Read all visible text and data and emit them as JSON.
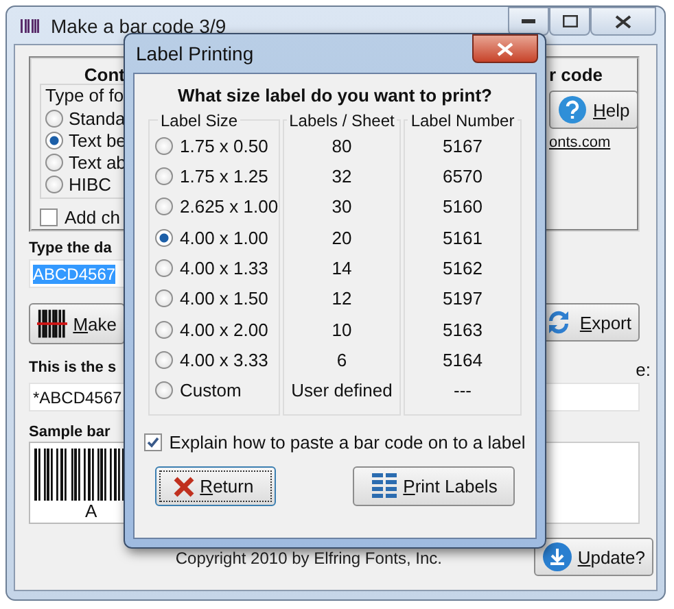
{
  "window": {
    "title": "Make a bar code 3/9"
  },
  "options": {
    "heading": "Cont",
    "type_label": "Type of fo",
    "types": [
      {
        "label": "Standa",
        "selected": false
      },
      {
        "label": "Text be",
        "selected": true
      },
      {
        "label": "Text ab",
        "selected": false
      },
      {
        "label": "HIBC",
        "selected": false
      }
    ],
    "check_digit": {
      "label": "Add ch",
      "checked": false
    }
  },
  "help_panel": {
    "heading": "r code",
    "help_button": "Help",
    "link": "onts.com"
  },
  "data_entry": {
    "label": "Type the da",
    "value": "ABCD4567"
  },
  "make_button": "Make",
  "export_button": "Export",
  "symbol": {
    "label": "This is the s",
    "value": "*ABCD4567",
    "right_label": "e:"
  },
  "sample": {
    "label": "Sample bar",
    "caption": "A"
  },
  "copyright": "Copyright 2010 by Elfring Fonts, Inc.",
  "update_button": "Update?",
  "dialog": {
    "title": "Label Printing",
    "question": "What size label do you want to print?",
    "columns": [
      "Label Size",
      "Labels / Sheet",
      "Label Number"
    ],
    "rows": [
      {
        "size": "1.75 x 0.50",
        "count": "80",
        "number": "5167",
        "selected": false
      },
      {
        "size": "1.75 x 1.25",
        "count": "32",
        "number": "6570",
        "selected": false
      },
      {
        "size": "2.625 x 1.00",
        "count": "30",
        "number": "5160",
        "selected": false
      },
      {
        "size": "4.00 x 1.00",
        "count": "20",
        "number": "5161",
        "selected": true
      },
      {
        "size": "4.00 x 1.33",
        "count": "14",
        "number": "5162",
        "selected": false
      },
      {
        "size": "4.00 x 1.50",
        "count": "12",
        "number": "5197",
        "selected": false
      },
      {
        "size": "4.00 x 2.00",
        "count": "10",
        "number": "5163",
        "selected": false
      },
      {
        "size": "4.00 x 3.33",
        "count": "6",
        "number": "5164",
        "selected": false
      },
      {
        "size": "Custom",
        "count": "User defined",
        "number": "---",
        "selected": false
      }
    ],
    "explain": {
      "label": "Explain how to paste a bar code on to a label",
      "checked": true
    },
    "return_button": "Return",
    "print_button": "Print Labels"
  }
}
